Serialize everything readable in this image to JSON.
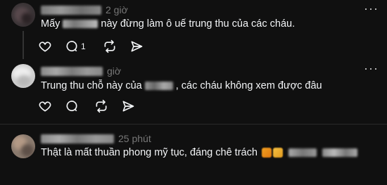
{
  "comments": [
    {
      "time": "2 giờ",
      "text_before": "Mấy",
      "text_after": "này đừng làm ô uế trung thu của các cháu.",
      "replies": "1"
    },
    {
      "time": "giờ",
      "text_before": "Trung thu chỗ này của",
      "text_after": ", các cháu không xem được đâu"
    },
    {
      "time": "25 phút",
      "text_before": "Thật là mất thuần phong mỹ tục, đáng chê trách"
    }
  ],
  "icons": {
    "more": "more-horizontal-icon",
    "like": "heart-icon",
    "reply": "comment-icon",
    "repost": "repost-icon",
    "share": "send-icon"
  },
  "colors": {
    "background": "#101010",
    "text": "#f3f5f7",
    "muted": "#777777",
    "divider": "#2a2a2a"
  }
}
